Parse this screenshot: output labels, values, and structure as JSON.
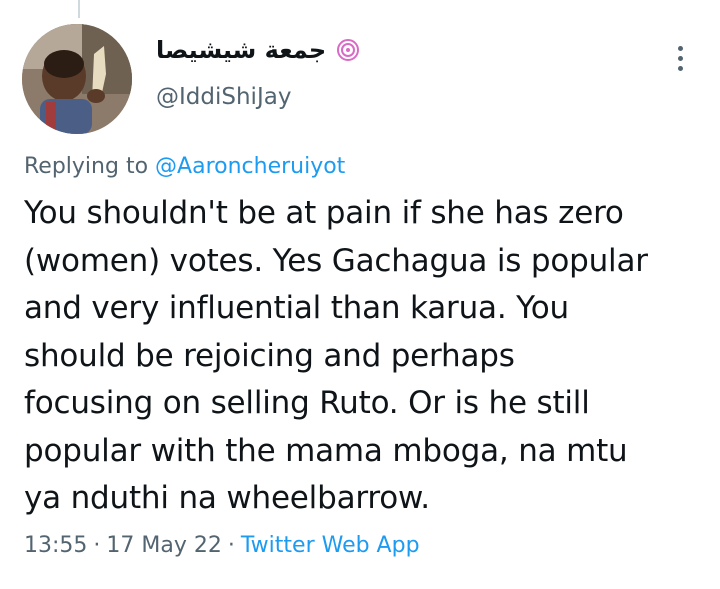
{
  "author": {
    "display_name": "جمعة شيشيصا",
    "handle": "@IddiShiJay",
    "avatar_icon": "child-photo-avatar",
    "emoji_icon": "cyclone-emoji-icon"
  },
  "reply": {
    "prefix": "Replying to",
    "target": "@Aaroncheruiyot"
  },
  "tweet": {
    "text": "You shouldn't be at pain if she has zero\n(women) votes. Yes Gachagua is popular\nand very influential than karua. You\nshould be rejoicing and perhaps\nfocusing on selling Ruto. Or is he still\npopular with the mama mboga, na mtu\nya nduthi na wheelbarrow."
  },
  "meta": {
    "time": "13:55",
    "sep1": "·",
    "date": "17 May 22",
    "sep2": "·",
    "source": "Twitter Web App"
  },
  "colors": {
    "link": "#1d9bf0",
    "secondary_text": "#536471",
    "primary_text": "#0f1419"
  }
}
